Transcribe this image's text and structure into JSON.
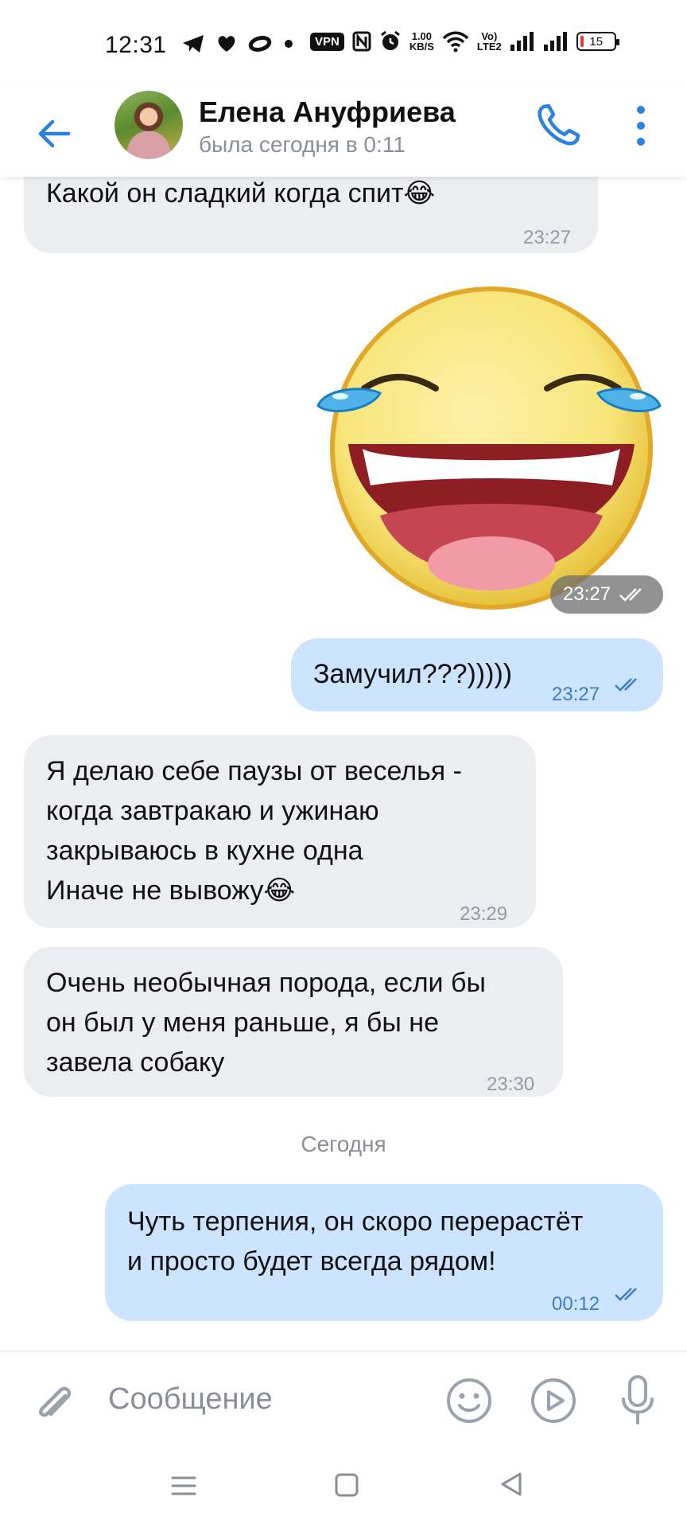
{
  "status_bar": {
    "time": "12:31",
    "vpn": "VPN",
    "net_speed_value": "1.00",
    "net_speed_unit": "KB/S",
    "volte_top": "Vo)",
    "volte_bottom": "LTE2",
    "battery": "15"
  },
  "header": {
    "contact_name": "Елена Ануфриева",
    "contact_status": "была сегодня в 0:11"
  },
  "messages": [
    {
      "direction": "in",
      "text": "Какой он сладкий когда спит😂",
      "time": "23:27"
    },
    {
      "direction": "out",
      "type": "sticker",
      "sticker": "laughing-crying-face",
      "time": "23:27",
      "read": true
    },
    {
      "direction": "out",
      "text": "Замучил???)))))",
      "time": "23:27",
      "read": true
    },
    {
      "direction": "in",
      "lines": [
        "Я делаю себе паузы от веселья -",
        "когда завтракаю и ужинаю",
        "закрываюсь в кухне одна",
        "Иначе не вывожу😂"
      ],
      "time": "23:29"
    },
    {
      "direction": "in",
      "lines": [
        "Очень необычная порода, если бы",
        "он был у меня раньше, я бы не",
        "завела собаку"
      ],
      "time": "23:30"
    },
    {
      "direction": "out",
      "lines": [
        "Чуть терпения, он скоро перерастёт",
        "и просто будет всегда рядом!"
      ],
      "time": "00:12",
      "read": true
    }
  ],
  "date_separator": "Сегодня",
  "composer": {
    "placeholder": "Сообщение"
  },
  "colors": {
    "accent": "#2d81e0",
    "incoming_bubble": "#ebedf0",
    "outgoing_bubble": "#cce4ff",
    "time_out": "#3a7ec8"
  }
}
